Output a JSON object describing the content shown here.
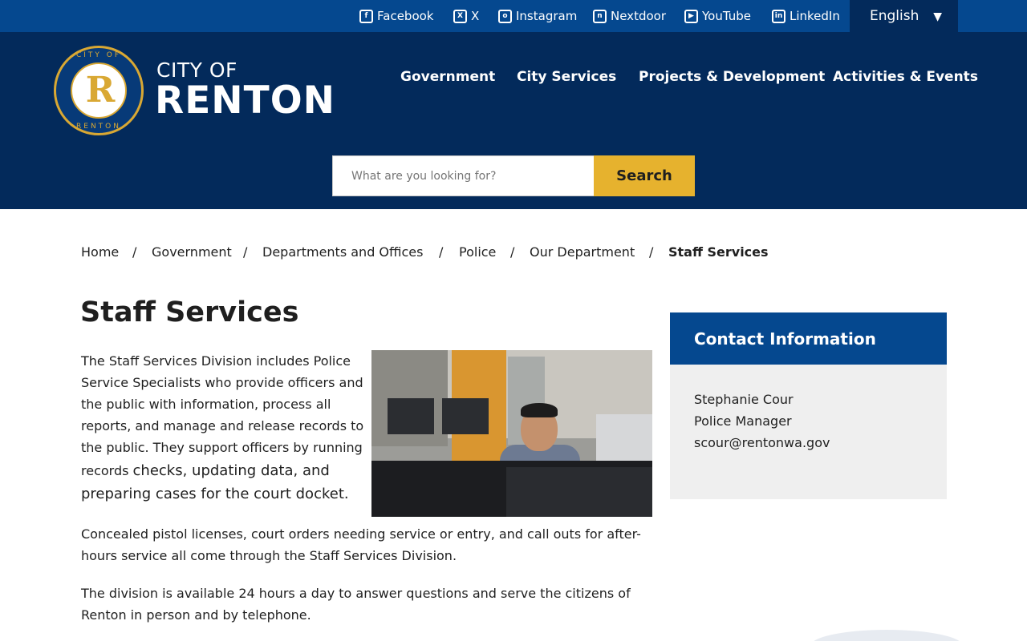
{
  "topbar": {
    "social": [
      {
        "label": "Facebook",
        "icon": "facebook-icon",
        "glyph": "f"
      },
      {
        "label": "X",
        "icon": "x-icon",
        "glyph": "X"
      },
      {
        "label": "Instagram",
        "icon": "instagram-icon",
        "glyph": "o"
      },
      {
        "label": "Nextdoor",
        "icon": "nextdoor-icon",
        "glyph": "n"
      },
      {
        "label": "YouTube",
        "icon": "youtube-icon",
        "glyph": "▶"
      },
      {
        "label": "LinkedIn",
        "icon": "linkedin-icon",
        "glyph": "in"
      }
    ],
    "language": "English",
    "language_caret": "▼"
  },
  "header": {
    "logo_line1": "CITY OF",
    "logo_line2": "RENTON",
    "seal_top": "CITY OF",
    "seal_bottom": "RENTON",
    "seal_letter": "R",
    "nav": [
      "Government",
      "City Services",
      "Projects & Development",
      "Activities & Events"
    ],
    "search_placeholder": "What are you looking for?",
    "search_button": "Search"
  },
  "breadcrumb": {
    "items": [
      "Home",
      "Government",
      "Departments and Offices",
      "Police",
      "Our Department",
      "Staff Services"
    ],
    "separator": "/"
  },
  "main": {
    "title": "Staff Services",
    "intro_lines_small": [
      "The Staff Services Division includes Police",
      "Service Specialists who provide officers and",
      "the public with information, process all",
      "reports, and manage and release records to",
      "the public. They support officers by running"
    ],
    "intro_line_mixed_a": "records ",
    "intro_line_mixed_b": "checks, updating data, and",
    "intro_line_last": "preparing cases for the court docket.",
    "para2_lines": [
      "Concealed pistol licenses, court orders needing service or entry, and call outs for after-",
      "hours service all come through the Staff Services Division."
    ],
    "para3_lines": [
      "The division is available 24 hours a day to answer questions and serve the citizens of",
      "Renton in person and by telephone."
    ]
  },
  "sidebar": {
    "heading": "Contact Information",
    "name": "Stephanie Cour",
    "role": "Police Manager",
    "email": "scour@rentonwa.gov"
  },
  "colors": {
    "topbar": "#05488f",
    "header": "#032a5b",
    "accent_gold": "#e6b22e",
    "sidebar_head": "#05488f",
    "sidebar_body": "#efefef"
  }
}
